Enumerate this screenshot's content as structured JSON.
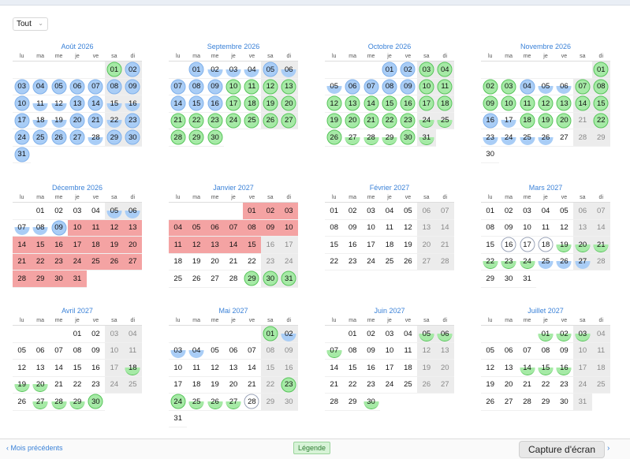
{
  "filter": {
    "value": "Tout"
  },
  "weekday_labels": [
    "lu",
    "ma",
    "me",
    "je",
    "ve",
    "sa",
    "di"
  ],
  "months": [
    {
      "title": "Août 2026",
      "offset": 5,
      "days": 31
    },
    {
      "title": "Septembre 2026",
      "offset": 1,
      "days": 30
    },
    {
      "title": "Octobre 2026",
      "offset": 3,
      "days": 31
    },
    {
      "title": "Novembre 2026",
      "offset": 6,
      "days": 30
    },
    {
      "title": "Décembre 2026",
      "offset": 1,
      "days": 31
    },
    {
      "title": "Janvier 2027",
      "offset": 4,
      "days": 31
    },
    {
      "title": "Février 2027",
      "offset": 0,
      "days": 28
    },
    {
      "title": "Mars 2027",
      "offset": 0,
      "days": 31
    },
    {
      "title": "Avril 2027",
      "offset": 3,
      "days": 30
    },
    {
      "title": "Mai 2027",
      "offset": 5,
      "days": 31
    },
    {
      "title": "Juin 2027",
      "offset": 1,
      "days": 30
    },
    {
      "title": "Juillet 2027",
      "offset": 3,
      "days": 31
    }
  ],
  "footer": {
    "prev_label": "Mois précédents",
    "legend_label": "Légende",
    "tooltip_label": "Capture d'écran",
    "next_icon": "chevron-right-icon"
  },
  "colors": {
    "blue": "#a9cdf6",
    "green": "#a6eaa6",
    "red": "#f4a3a3",
    "accent": "#3b82d8"
  }
}
